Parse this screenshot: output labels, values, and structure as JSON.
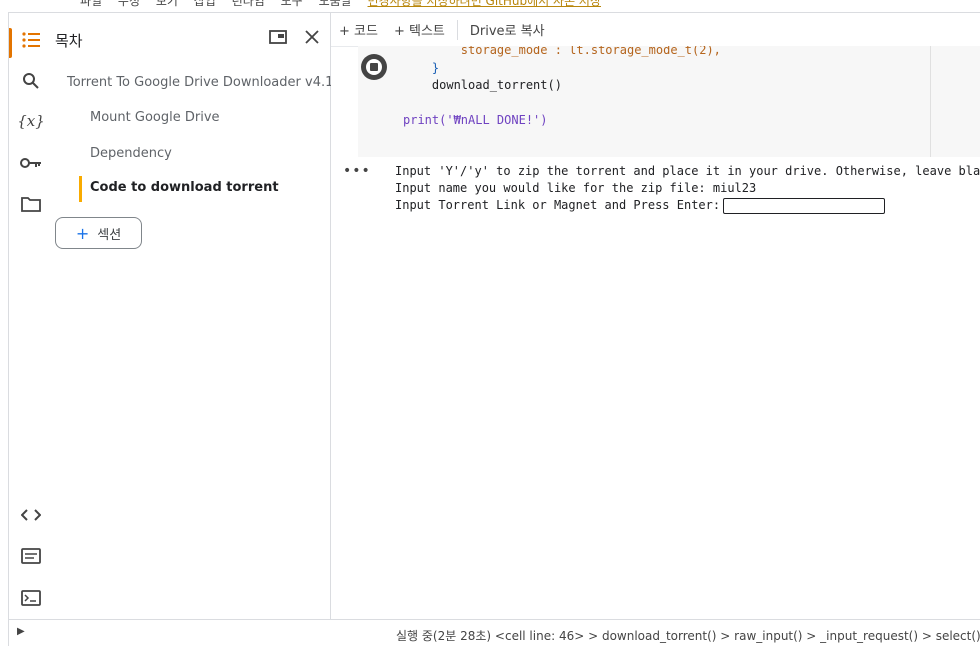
{
  "top_menu": {
    "items": [
      "파일",
      "수정",
      "보기",
      "삽입",
      "런타임",
      "도구",
      "도움말"
    ],
    "link": "변경사항을 저장하려면 GitHub에서 사본 저장"
  },
  "left_rail": {
    "icons": [
      "toc-list-icon",
      "search-icon",
      "variables-icon",
      "key-icon",
      "folder-icon",
      "code-icon",
      "terminal-list-icon",
      "terminal-icon"
    ],
    "variables_label": "{x}"
  },
  "toc": {
    "title": "목차",
    "items": [
      {
        "label": "Torrent To Google Drive Downloader v4.1"
      },
      {
        "label": "Mount Google Drive"
      },
      {
        "label": "Dependency"
      },
      {
        "label": "Code to download torrent"
      }
    ],
    "section_button": "섹션",
    "plus": "+"
  },
  "toolbar": {
    "code": "+ 코드",
    "text": "+ 텍스트",
    "copy_to_drive": "Drive로 복사"
  },
  "code_cell": {
    "lines": [
      {
        "parts": [
          "",
          "storage_mode",
          " : lt.storage_mode_t(2),"
        ]
      },
      {
        "parts": [
          "}"
        ]
      },
      {
        "parts": [
          "download_torrent()"
        ]
      },
      {
        "parts": [
          ""
        ]
      },
      {
        "parts": [
          "print('₩nALL DONE!')"
        ]
      }
    ]
  },
  "output": {
    "dots": "•••",
    "line1": "Input 'Y'/'y' to zip the torrent and place it in your drive. Otherwise, leave blank. y",
    "line2": "Input name you would like for the zip file: miul23",
    "line3": "Input Torrent Link or Magnet and Press Enter:",
    "input_value": ""
  },
  "status": {
    "text": "실행 중(2분 28초) <cell line: 46> > download_torrent() > raw_input() > _input_request() > select()"
  },
  "colors": {
    "accent_orange": "#e37400",
    "toc_marker": "#f9ab00",
    "link_blue": "#1a73e8"
  }
}
